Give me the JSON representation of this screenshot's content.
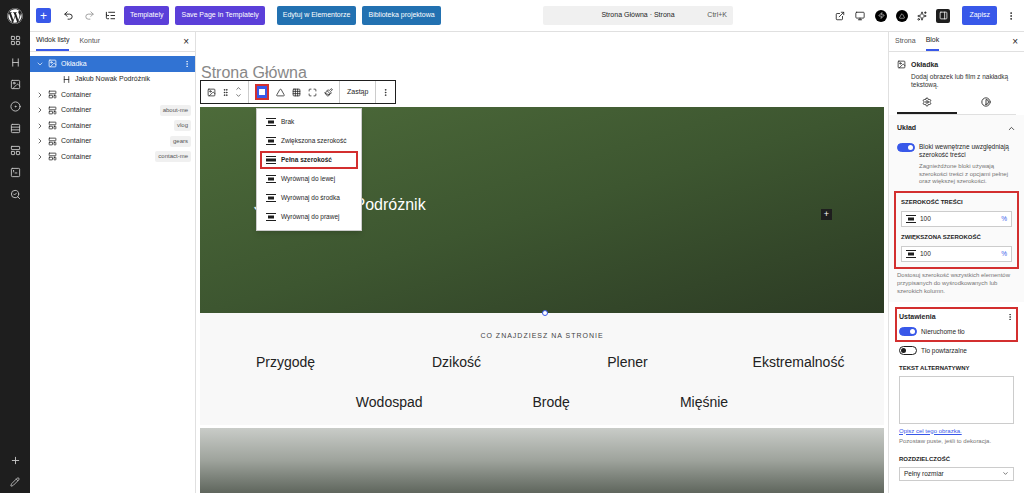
{
  "toolbar": {
    "add": "+",
    "plugin_buttons": [
      {
        "label": "Templately",
        "color": "#5b3fd9"
      },
      {
        "label": "Save Page In Templately",
        "color": "#5b3fd9"
      },
      {
        "label": "Edytuj w Elementorze",
        "color": "#2271b1"
      },
      {
        "label": "Biblioteka projektowa",
        "color": "#2271b1"
      }
    ],
    "command": {
      "title": "Strona Główna · Strona",
      "shortcut": "Ctrl+K"
    },
    "sidebar_toggle_on": true,
    "save": "Zapisz"
  },
  "list_view": {
    "tabs": [
      {
        "label": "Widok listy",
        "selected": true
      },
      {
        "label": "Kontur",
        "selected": false
      }
    ],
    "close": "×",
    "items": [
      {
        "label": "Okładka",
        "kind": "cover",
        "depth": 0,
        "expanded": true,
        "has_children": true,
        "selected": true,
        "anchor": ""
      },
      {
        "label": "Jakub Nowak Podróżnik",
        "kind": "heading",
        "depth": 1,
        "expanded": false,
        "has_children": false,
        "selected": false,
        "anchor": ""
      },
      {
        "label": "Container",
        "kind": "group",
        "depth": 0,
        "expanded": false,
        "has_children": true,
        "selected": false,
        "anchor": ""
      },
      {
        "label": "Container",
        "kind": "group",
        "depth": 0,
        "expanded": false,
        "has_children": true,
        "selected": false,
        "anchor": "about-me"
      },
      {
        "label": "Container",
        "kind": "group",
        "depth": 0,
        "expanded": false,
        "has_children": true,
        "selected": false,
        "anchor": "vlog"
      },
      {
        "label": "Container",
        "kind": "group",
        "depth": 0,
        "expanded": false,
        "has_children": true,
        "selected": false,
        "anchor": "gears"
      },
      {
        "label": "Container",
        "kind": "group",
        "depth": 0,
        "expanded": false,
        "has_children": true,
        "selected": false,
        "anchor": "contact-me"
      }
    ]
  },
  "canvas": {
    "page_title": "Strona Główna",
    "block_toolbar": {
      "replace": "Zastąp",
      "align_open": true,
      "align_highlighted": true
    },
    "align_menu": [
      {
        "label": "Brak",
        "selected": false,
        "highlighted": false
      },
      {
        "label": "Zwiększona szerokość",
        "selected": false,
        "highlighted": false
      },
      {
        "label": "Pełna szerokość",
        "selected": true,
        "highlighted": true
      },
      {
        "label": "Wyrównaj do lewej",
        "selected": false,
        "highlighted": false
      },
      {
        "label": "Wyrównaj do środka",
        "selected": false,
        "highlighted": false
      },
      {
        "label": "Wyrównaj do prawej",
        "selected": false,
        "highlighted": false
      }
    ],
    "cover_text": "Jakub Nowak Podróżnik",
    "add_block": "+",
    "section": {
      "eyebrow": "CO ZNAJDZIESZ NA STRONIE",
      "rows": [
        [
          "Przygodę",
          "Dzikość",
          "Plener",
          "Ekstremalność"
        ],
        [
          "Wodospad",
          "Brodę",
          "Mięśnie"
        ]
      ]
    }
  },
  "sidebar": {
    "tabs": [
      {
        "label": "Strona",
        "selected": false
      },
      {
        "label": "Blok",
        "selected": true
      }
    ],
    "close": "×",
    "block": {
      "title": "Okładka",
      "description": "Dodaj obrazek lub film z nakładką tekstową."
    },
    "style_tabs": [
      {
        "kind": "settings",
        "selected": true
      },
      {
        "kind": "styles",
        "selected": false
      }
    ],
    "layout": {
      "title": "Układ",
      "expanded": true,
      "toggle": {
        "label": "Bloki wewnętrzne uwzględniają szerokość treści",
        "on": true
      },
      "toggle_help": "Zagnieżdżone bloki używają szerokości treści z opcjami pełnej oraz większej szerokości.",
      "highlighted": true,
      "fields": [
        {
          "label": "SZEROKOŚĆ TREŚCI",
          "value": "100",
          "unit": "%"
        },
        {
          "label": "ZWIĘKSZONA SZEROKOŚĆ",
          "value": "100",
          "unit": "%"
        }
      ],
      "help": "Dostosuj szerokość wszystkich elementów przypisanych do wyśrodkowanych lub szerokich kolumn."
    },
    "settings": {
      "title": "Ustawienia",
      "highlighted": true,
      "toggles": [
        {
          "label": "Nieruchome tło",
          "on": true
        },
        {
          "label": "Tło powtarzalne",
          "on": false
        }
      ]
    },
    "alt": {
      "label": "TEKST ALTERNATYWNY",
      "value": "",
      "link": "Opisz cel tego obrazka.",
      "help": "Pozostaw puste, jeśli to dekoracja."
    },
    "resolution": {
      "label": "ROZDZIELCZOŚĆ",
      "value": "Pełny rozmiar"
    }
  }
}
